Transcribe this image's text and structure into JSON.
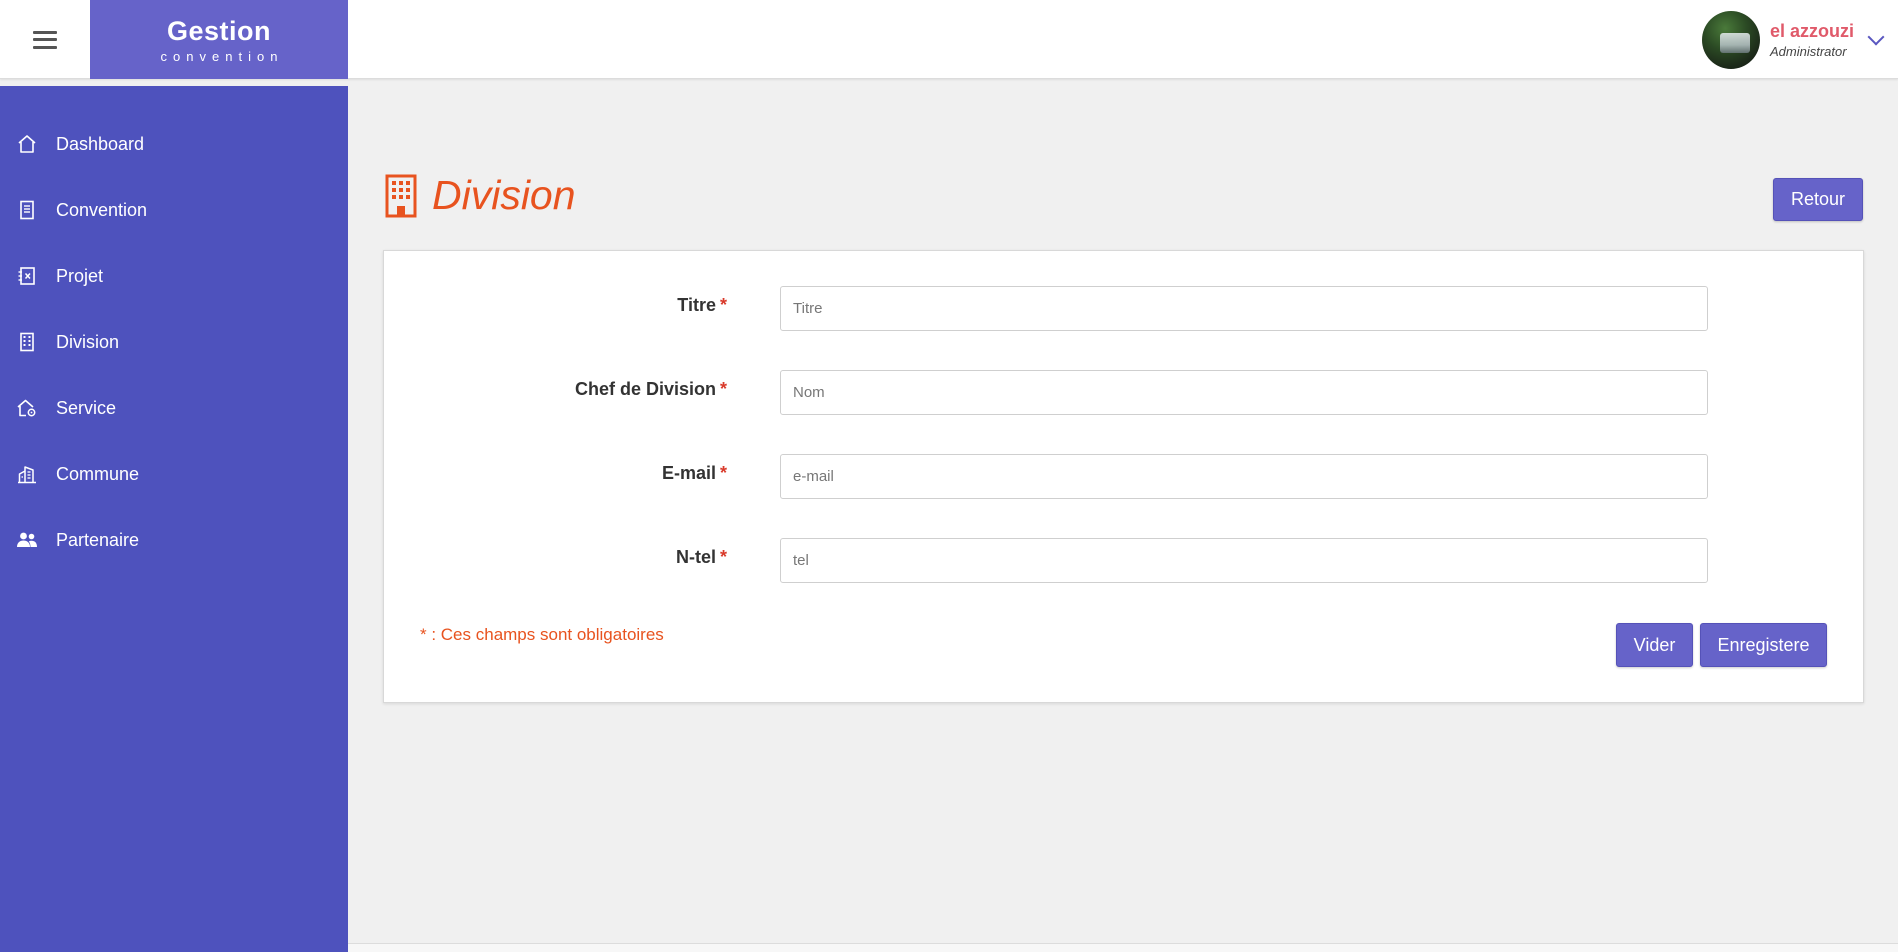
{
  "brand": {
    "title": "Gestion",
    "subtitle": "convention"
  },
  "user": {
    "name": "el azzouzi",
    "role": "Administrator"
  },
  "sidebar": {
    "items": [
      {
        "label": "Dashboard",
        "icon": "home-icon"
      },
      {
        "label": "Convention",
        "icon": "document-icon"
      },
      {
        "label": "Projet",
        "icon": "project-icon"
      },
      {
        "label": "Division",
        "icon": "building-icon"
      },
      {
        "label": "Service",
        "icon": "house-gear-icon"
      },
      {
        "label": "Commune",
        "icon": "city-icon"
      },
      {
        "label": "Partenaire",
        "icon": "users-icon"
      }
    ]
  },
  "page": {
    "title": "Division",
    "title_icon": "building-icon",
    "back_label": "Retour"
  },
  "form": {
    "fields": [
      {
        "label": "Titre",
        "required": "*",
        "placeholder": "Titre",
        "value": ""
      },
      {
        "label": "Chef de Division",
        "required": "*",
        "placeholder": "Nom",
        "value": ""
      },
      {
        "label": "E-mail",
        "required": "*",
        "placeholder": "e-mail",
        "value": ""
      },
      {
        "label": "N-tel",
        "required": "*",
        "placeholder": "tel",
        "value": ""
      }
    ],
    "note": "* : Ces champs sont obligatoires",
    "clear_label": "Vider",
    "save_label": "Enregistere"
  },
  "colors": {
    "accent": "#6663c9",
    "sidebar": "#4e52bd",
    "title": "#e8531f",
    "user_name": "#e05a6a",
    "required": "#d93a2b"
  }
}
